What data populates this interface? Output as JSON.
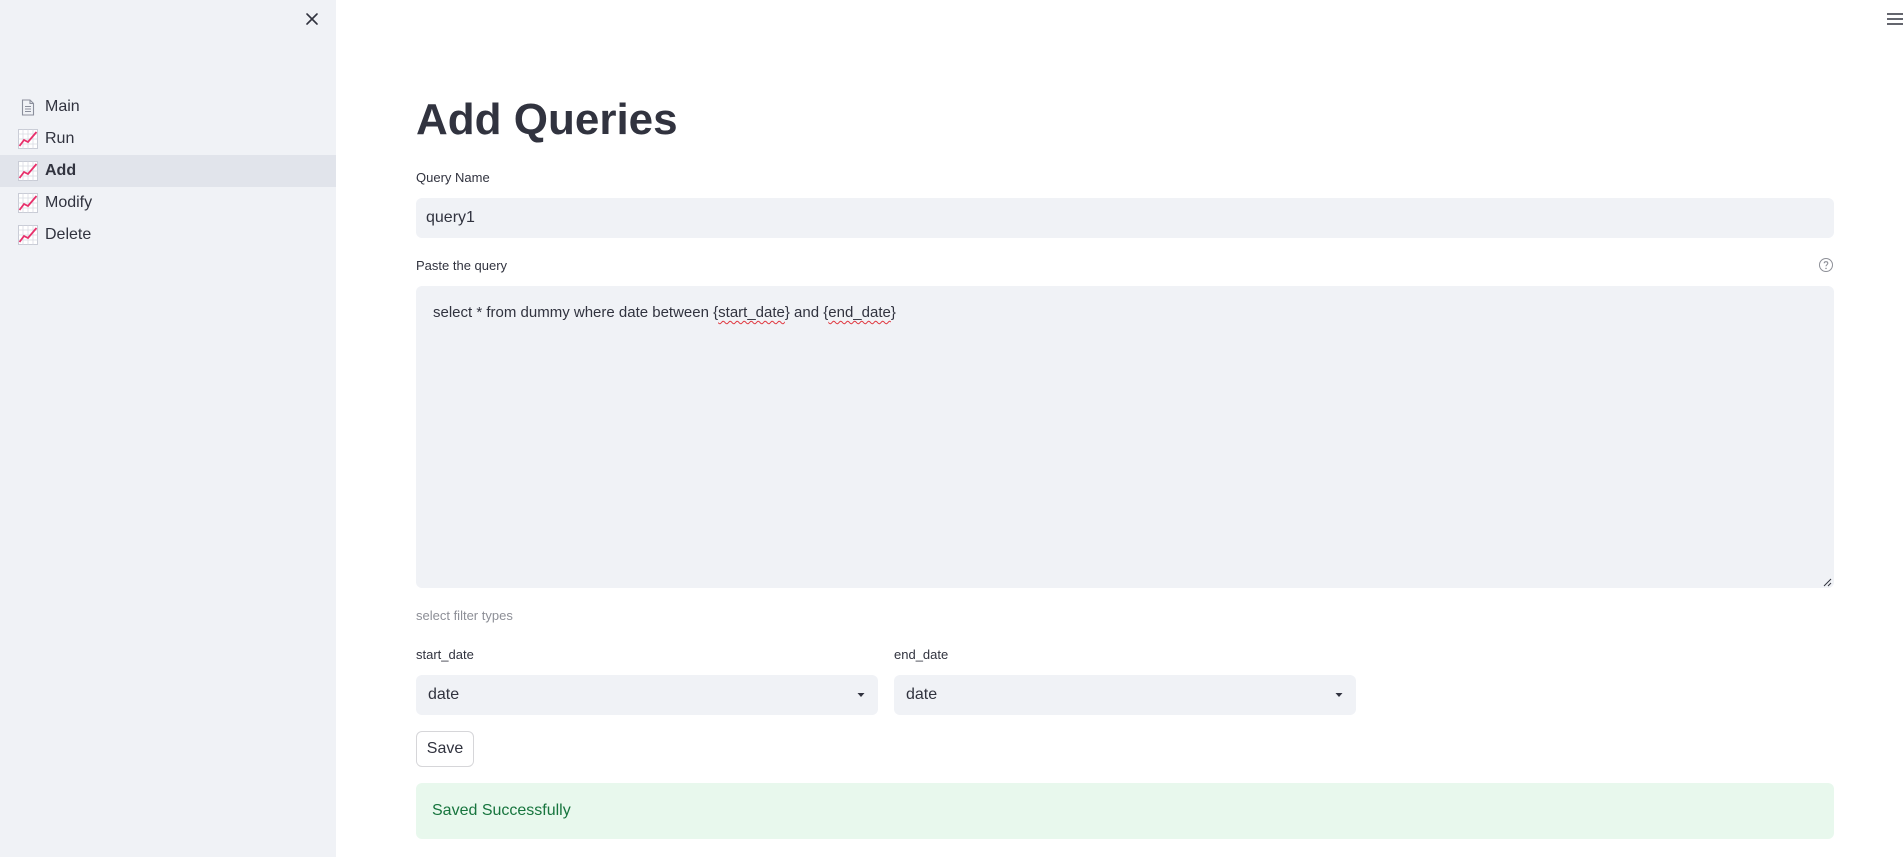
{
  "sidebar": {
    "items": [
      {
        "label": "Main",
        "icon": "document-icon",
        "active": false
      },
      {
        "label": "Run",
        "icon": "chart-increasing-icon",
        "active": false
      },
      {
        "label": "Add",
        "icon": "chart-increasing-icon",
        "active": true
      },
      {
        "label": "Modify",
        "icon": "chart-increasing-icon",
        "active": false
      },
      {
        "label": "Delete",
        "icon": "chart-increasing-icon",
        "active": false
      }
    ]
  },
  "page": {
    "title": "Add Queries"
  },
  "form": {
    "query_name_label": "Query Name",
    "query_name_value": "query1",
    "query_label": "Paste the query",
    "query_value": {
      "part1": "select * from dummy where date between ",
      "brace1_open": "{",
      "token1": "start_date",
      "brace1_close": "}",
      "part2": " and ",
      "brace2_open": "{",
      "token2": "end_date",
      "brace2_close": "}"
    },
    "filter_caption": "select filter types",
    "filters": [
      {
        "label": "start_date",
        "value": "date"
      },
      {
        "label": "end_date",
        "value": "date"
      }
    ],
    "save_label": "Save"
  },
  "alert": {
    "message": "Saved Successfully",
    "color": "#17753e",
    "background": "#e8f8ed"
  },
  "colors": {
    "sidebar_bg": "#f0f2f6",
    "active_item_bg": "#e1e4eb",
    "input_bg": "#f0f2f6",
    "text": "#31333f",
    "chart_icon_line": "#e8306b"
  }
}
